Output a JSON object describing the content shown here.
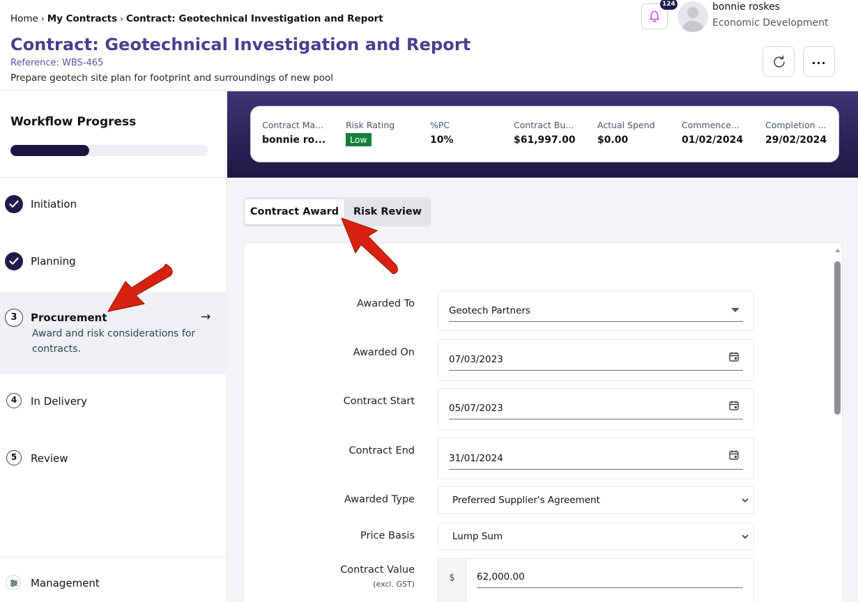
{
  "breadcrumb": {
    "home": "Home",
    "my_contracts": "My Contracts",
    "current": "Contract: Geotechnical Investigation and Report"
  },
  "header": {
    "title": "Contract: Geotechnical Investigation and Report",
    "reference": "Reference: WBS-465",
    "description": "Prepare geotech site plan for footprint and surroundings of new pool",
    "notification_count": "124",
    "more_label": "..."
  },
  "user": {
    "name": "bonnie roskes",
    "department": "Economic Development"
  },
  "workflow": {
    "title": "Workflow Progress",
    "progress": 0.4,
    "steps": [
      {
        "num": "1",
        "label": "Initiation",
        "status": "done"
      },
      {
        "num": "2",
        "label": "Planning",
        "status": "done"
      },
      {
        "num": "3",
        "label": "Procurement",
        "status": "active",
        "description": "Award and risk considerations for contracts."
      },
      {
        "num": "4",
        "label": "In Delivery",
        "status": "pending"
      },
      {
        "num": "5",
        "label": "Review",
        "status": "pending"
      }
    ],
    "management_label": "Management"
  },
  "stats": [
    {
      "label": "Contract Ma...",
      "value": "bonnie ro..."
    },
    {
      "label": "Risk Rating",
      "value": "Low"
    },
    {
      "label": "%PC",
      "value": "10%"
    },
    {
      "label": "Contract Bu...",
      "value": "$61,997.00"
    },
    {
      "label": "Actual Spend",
      "value": "$0.00"
    },
    {
      "label": "Commence...",
      "value": "01/02/2024"
    },
    {
      "label": "Completion ...",
      "value": "29/02/2024"
    }
  ],
  "tabs": [
    {
      "label": "Contract Award",
      "active": true
    },
    {
      "label": "Risk Review",
      "active": false
    }
  ],
  "form": {
    "awarded_to": {
      "label": "Awarded To",
      "value": "Geotech Partners"
    },
    "awarded_on": {
      "label": "Awarded On",
      "value": "07/03/2023"
    },
    "contract_start": {
      "label": "Contract Start",
      "value": "05/07/2023"
    },
    "contract_end": {
      "label": "Contract End",
      "value": "31/01/2024"
    },
    "awarded_type": {
      "label": "Awarded Type",
      "value": "Preferred Supplier's Agreement"
    },
    "price_basis": {
      "label": "Price Basis",
      "value": "Lump Sum"
    },
    "contract_value": {
      "label": "Contract Value",
      "sublabel": "(excl. GST)",
      "prefix": "$",
      "value": "62,000.00"
    }
  },
  "colors": {
    "brand_purple": "#4c3d8f",
    "banner_dark": "#1d1843",
    "risk_low": "#15803d",
    "annotation_red": "#d8220f"
  }
}
